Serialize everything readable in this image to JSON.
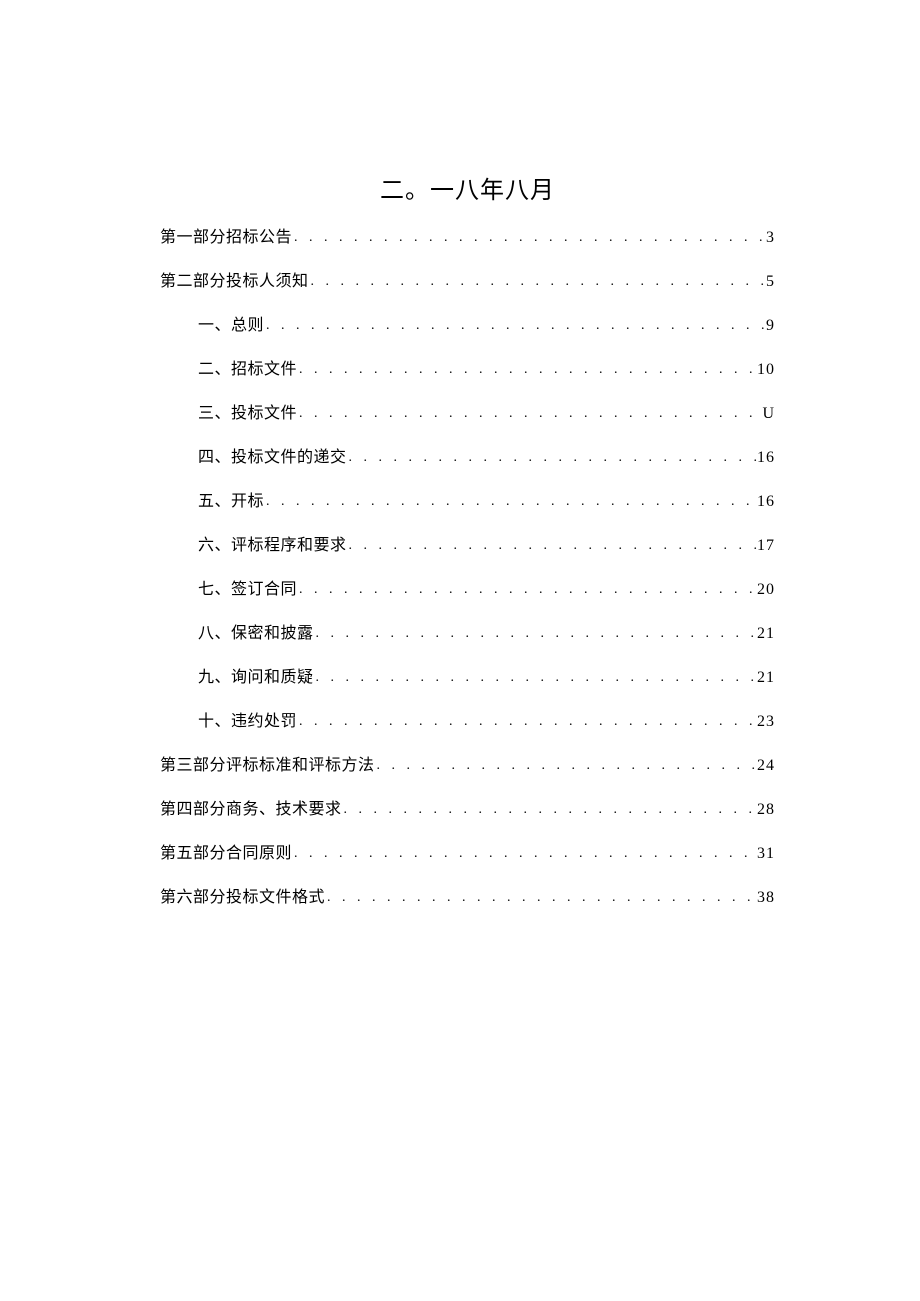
{
  "title": "二。一八年八月",
  "toc": [
    {
      "label": "第一部分招标公告",
      "page": "3",
      "sub": false
    },
    {
      "label": "第二部分投标人须知",
      "page": "5",
      "sub": false
    },
    {
      "label": "一、总则",
      "page": "9",
      "sub": true
    },
    {
      "label": "二、招标文件",
      "page": "10",
      "sub": true
    },
    {
      "label": "三、投标文件",
      "page": "U",
      "sub": true
    },
    {
      "label": "四、投标文件的递交",
      "page": "16",
      "sub": true
    },
    {
      "label": "五、开标",
      "page": "16",
      "sub": true
    },
    {
      "label": "六、评标程序和要求",
      "page": "17",
      "sub": true
    },
    {
      "label": "七、签订合同",
      "page": "20",
      "sub": true
    },
    {
      "label": "八、保密和披露",
      "page": "21",
      "sub": true
    },
    {
      "label": "九、询问和质疑",
      "page": "21",
      "sub": true
    },
    {
      "label": "十、违约处罚",
      "page": "23",
      "sub": true
    },
    {
      "label": "第三部分评标标准和评标方法",
      "page": "24",
      "sub": false
    },
    {
      "label": "第四部分商务、技术要求",
      "page": "28",
      "sub": false
    },
    {
      "label": "第五部分合同原则",
      "page": "31",
      "sub": false
    },
    {
      "label": "第六部分投标文件格式",
      "page": "38",
      "sub": false
    }
  ]
}
